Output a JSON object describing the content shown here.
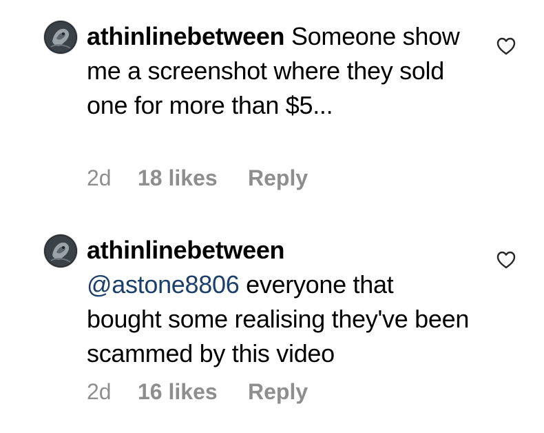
{
  "comments": [
    {
      "username": "athinlinebetween",
      "text": " Someone show me a screenshot where they sold one for more than $5...",
      "time": "2d",
      "likes": "18 likes",
      "reply_label": "Reply",
      "avatar_icon": "avatar-image",
      "like_icon": "heart-icon"
    },
    {
      "username": "athinlinebetween",
      "mention": "@astone8806",
      "text": " everyone that bought some realising they've been scammed by this video",
      "time": "2d",
      "likes": "16 likes",
      "reply_label": "Reply",
      "avatar_icon": "avatar-image",
      "like_icon": "heart-icon"
    }
  ],
  "colors": {
    "text": "#000000",
    "meta": "#8e8e8e",
    "mention": "#1a3f6b",
    "heart_stroke": "#262626"
  }
}
